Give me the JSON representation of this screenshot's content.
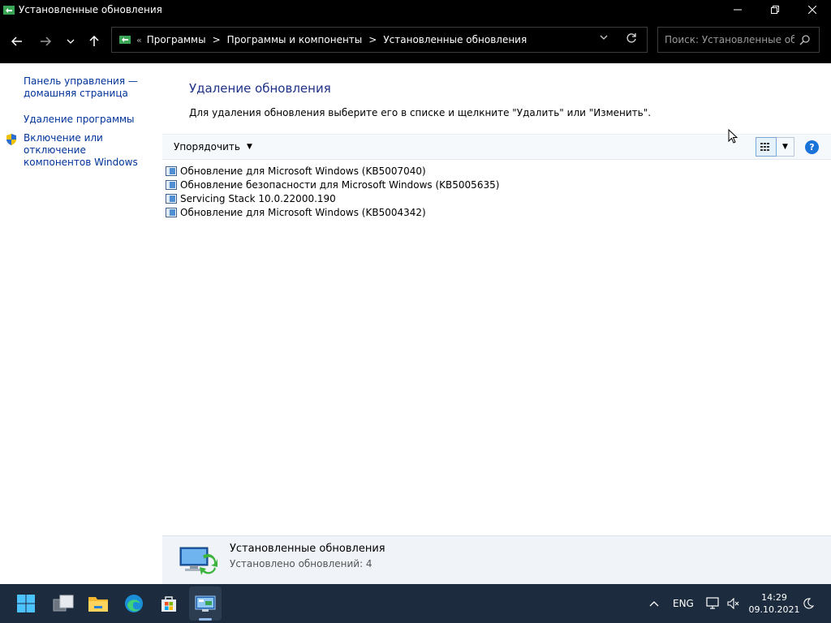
{
  "window": {
    "title": "Установленные обновления",
    "minimize_icon": "minimize-icon",
    "maximize_icon": "restore-icon",
    "close_icon": "close-icon"
  },
  "nav": {
    "back_icon": "arrow-left-icon",
    "forward_icon": "arrow-right-icon",
    "recent_icon": "chevron-down-icon",
    "up_icon": "arrow-up-icon",
    "breadcrumb_overflow": "«",
    "breadcrumbs": [
      "Программы",
      "Программы и компоненты",
      "Установленные обновления"
    ],
    "breadcrumb_separator": ">",
    "search_placeholder": "Поиск: Установленные об..."
  },
  "sidebar": {
    "items": [
      {
        "label_line1": "Панель управления —",
        "label_line2": "домашняя страница"
      },
      {
        "label_line1": "Удаление программы"
      },
      {
        "label_line1": "Включение или отключение",
        "label_line2": "компонентов Windows"
      }
    ]
  },
  "main": {
    "heading": "Удаление обновления",
    "description": "Для удаления обновления выберите его в списке и щелкните \"Удалить\" или \"Изменить\".",
    "toolbar": {
      "organize_label": "Упорядочить",
      "help_label": "?"
    },
    "updates": [
      "Обновление для Microsoft Windows (KB5007040)",
      "Обновление безопасности для Microsoft Windows (KB5005635)",
      "Servicing Stack 10.0.22000.190",
      "Обновление для Microsoft Windows (KB5004342)"
    ]
  },
  "details": {
    "title": "Установленные обновления",
    "subtitle": "Установлено обновлений: 4"
  },
  "taskbar": {
    "apps": [
      "windows-start-icon",
      "task-view-icon",
      "file-explorer-icon",
      "edge-icon",
      "store-icon",
      "control-panel-icon"
    ],
    "language": "ENG",
    "time": "14:29",
    "date": "09.10.2021"
  },
  "colors": {
    "link": "#003399",
    "heading": "#1e3287",
    "taskbar": "#1c2b3d"
  }
}
